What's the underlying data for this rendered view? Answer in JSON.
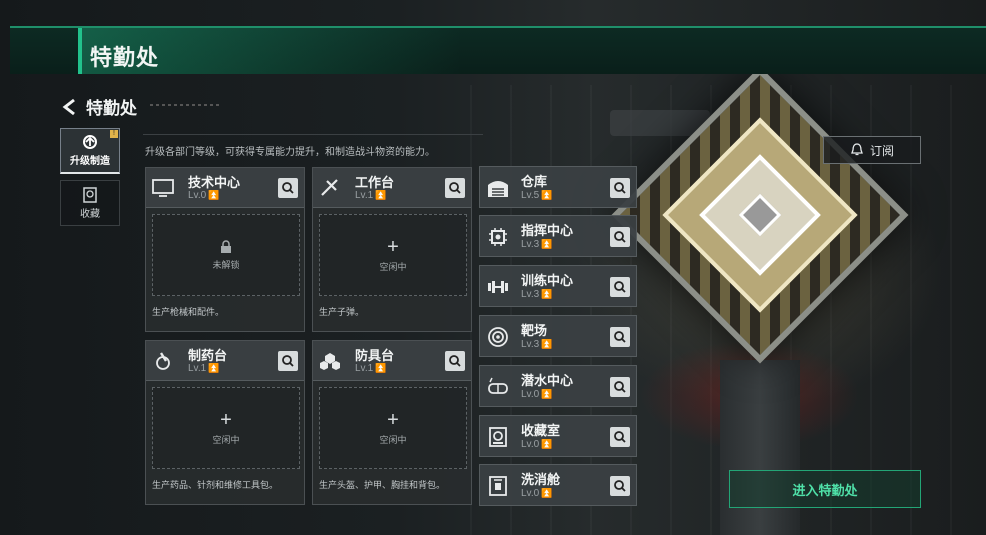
{
  "header": {
    "title": "特勤处"
  },
  "nav": {
    "back_label": "特勤处"
  },
  "sidebar": {
    "tabs": [
      {
        "label": "升级制造",
        "badge": "!",
        "icon": "upgrade-icon",
        "active": true
      },
      {
        "label": "收藏",
        "icon": "collection-icon",
        "active": false
      }
    ]
  },
  "description": "升级各部门等级，可获得专属能力提升，和制造战斗物资的能力。",
  "subscribe": {
    "label": "订阅"
  },
  "production_cards": [
    {
      "name": "技术中心",
      "level": "Lv.0",
      "slot_status": "未解锁",
      "note": "生产枪械和配件。",
      "icon": "monitor-icon",
      "locked": true
    },
    {
      "name": "工作台",
      "level": "Lv.1",
      "slot_status": "空闲中",
      "note": "生产子弹。",
      "icon": "tools-icon",
      "locked": false
    },
    {
      "name": "制药台",
      "level": "Lv.1",
      "slot_status": "空闲中",
      "note": "生产药品、针剂和维修工具包。",
      "icon": "microscope-icon",
      "locked": false
    },
    {
      "name": "防具台",
      "level": "Lv.1",
      "slot_status": "空闲中",
      "note": "生产头盔、护甲、胸挂和背包。",
      "icon": "armor-icon",
      "locked": false
    }
  ],
  "facilities": [
    {
      "name": "仓库",
      "level": "Lv.5",
      "icon": "warehouse-icon"
    },
    {
      "name": "指挥中心",
      "level": "Lv.3",
      "icon": "chip-icon"
    },
    {
      "name": "训练中心",
      "level": "Lv.3",
      "icon": "dumbbell-icon"
    },
    {
      "name": "靶场",
      "level": "Lv.3",
      "icon": "target-icon"
    },
    {
      "name": "潜水中心",
      "level": "Lv.0",
      "icon": "diving-mask-icon"
    },
    {
      "name": "收藏室",
      "level": "Lv.0",
      "icon": "vault-icon"
    },
    {
      "name": "洗消舱",
      "level": "Lv.0",
      "icon": "decon-icon"
    }
  ],
  "enter_button": {
    "label": "进入特勤处"
  },
  "colors": {
    "accent": "#22c28c",
    "level_up": "#c9a84a",
    "panel": "#3a3f42"
  }
}
